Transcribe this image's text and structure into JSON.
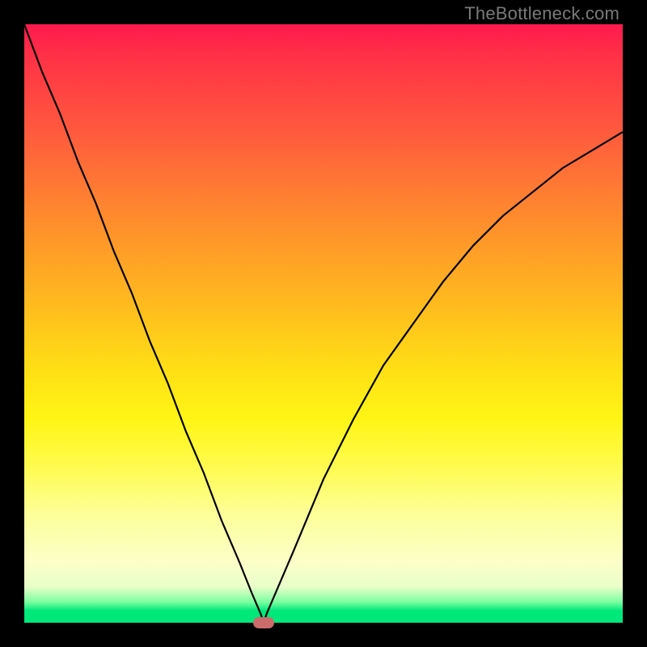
{
  "watermark": "TheBottleneck.com",
  "colors": {
    "frame": "#000000",
    "curve": "#000000",
    "marker": "#cc6b6b",
    "gradient_top": "#ff1a4d",
    "gradient_bottom": "#00e77a"
  },
  "chart_data": {
    "type": "line",
    "title": "",
    "xlabel": "",
    "ylabel": "",
    "xlim": [
      0,
      1
    ],
    "ylim": [
      0,
      1
    ],
    "x": [
      0.0,
      0.03,
      0.06,
      0.09,
      0.12,
      0.15,
      0.18,
      0.21,
      0.24,
      0.27,
      0.3,
      0.33,
      0.36,
      0.38,
      0.395,
      0.4,
      0.405,
      0.42,
      0.45,
      0.5,
      0.55,
      0.6,
      0.65,
      0.7,
      0.75,
      0.8,
      0.85,
      0.9,
      0.95,
      1.0
    ],
    "values": [
      1.0,
      0.92,
      0.85,
      0.77,
      0.7,
      0.62,
      0.55,
      0.47,
      0.4,
      0.32,
      0.25,
      0.17,
      0.1,
      0.05,
      0.015,
      0.0,
      0.015,
      0.05,
      0.12,
      0.24,
      0.34,
      0.43,
      0.5,
      0.57,
      0.63,
      0.68,
      0.72,
      0.76,
      0.79,
      0.82
    ],
    "marker": {
      "x": 0.4,
      "y": 0.0
    },
    "annotations": [],
    "legend": []
  }
}
